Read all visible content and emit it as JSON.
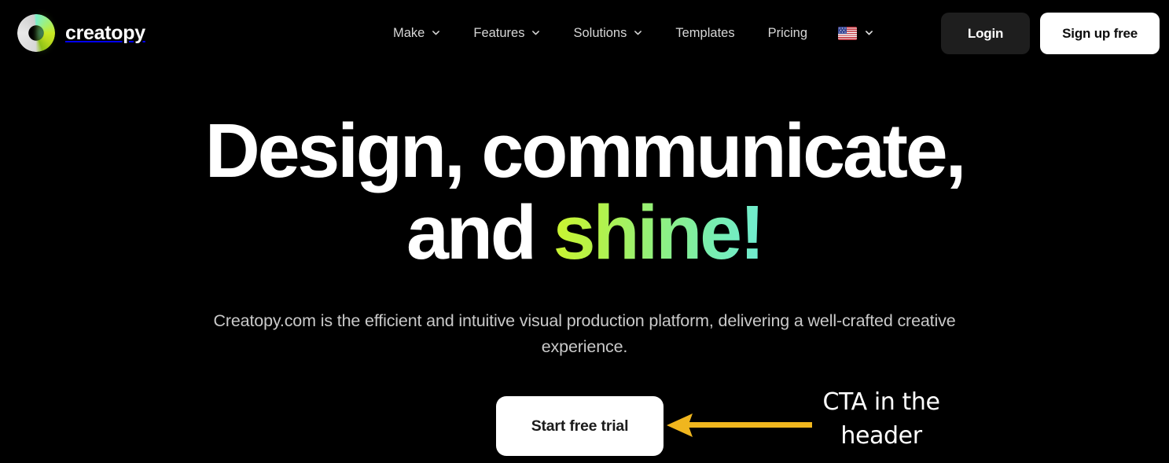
{
  "brand": {
    "name": "creatopy",
    "logo_icon": "creatopy-ring-logo"
  },
  "nav": {
    "items": [
      {
        "label": "Make",
        "has_dropdown": true
      },
      {
        "label": "Features",
        "has_dropdown": true
      },
      {
        "label": "Solutions",
        "has_dropdown": true
      },
      {
        "label": "Templates",
        "has_dropdown": false
      },
      {
        "label": "Pricing",
        "has_dropdown": false
      }
    ],
    "language": {
      "flag_icon": "us-flag-icon",
      "chevron_icon": "chevron-down-icon"
    }
  },
  "auth": {
    "login_label": "Login",
    "signup_label": "Sign up free"
  },
  "hero": {
    "headline_line1": "Design, communicate,",
    "headline_line2_plain": "and ",
    "headline_line2_accent": "shine!",
    "subcopy": "Creatopy.com is the efficient and intuitive visual production platform, delivering a well-crafted creative experience.",
    "cta_label": "Start free trial"
  },
  "annotation": {
    "text_line1": "CTA in the",
    "text_line2": "header",
    "arrow_icon": "left-arrow-annotation",
    "arrow_color": "#f0b61e",
    "text_color": "#ffffff"
  },
  "colors": {
    "background": "#000000",
    "text_primary": "#ffffff",
    "text_secondary": "#c9c9c9",
    "accent_gradient_start": "#cdf52e",
    "accent_gradient_end": "#6fecd4",
    "login_button_bg": "#1e1e1e",
    "signup_button_bg": "#ffffff",
    "cta_button_bg": "#ffffff"
  }
}
